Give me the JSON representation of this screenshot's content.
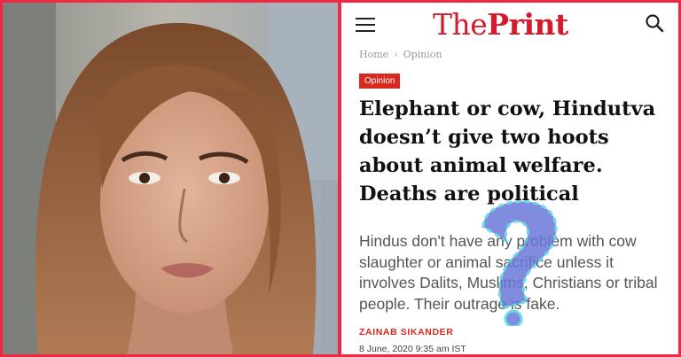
{
  "header": {
    "logo_the": "The",
    "logo_print": "Print",
    "menu_icon": "hamburger-menu-icon",
    "search_icon": "search-icon"
  },
  "breadcrumb": {
    "home": "Home",
    "separator": "›",
    "section": "Opinion"
  },
  "article": {
    "badge": "Opinion",
    "headline": "Elephant or cow, Hindutva doesn’t give two hoots about animal welfare. Deaths are political",
    "dek": "Hindus don't have any problem with cow slaughter or animal sacrifice unless it involves Dalits, Muslims, Christians or tribal people. Their outrage is fake.",
    "author": "ZAINAB SIKANDER",
    "date": "8 June, 2020 9:35 am IST"
  },
  "colors": {
    "frame": "#ec2a43",
    "brand_red": "#d41b2b",
    "badge_red": "#d7291f",
    "question_mark_fill": "#6a78d8",
    "question_mark_outline": "#4fd6e2"
  }
}
